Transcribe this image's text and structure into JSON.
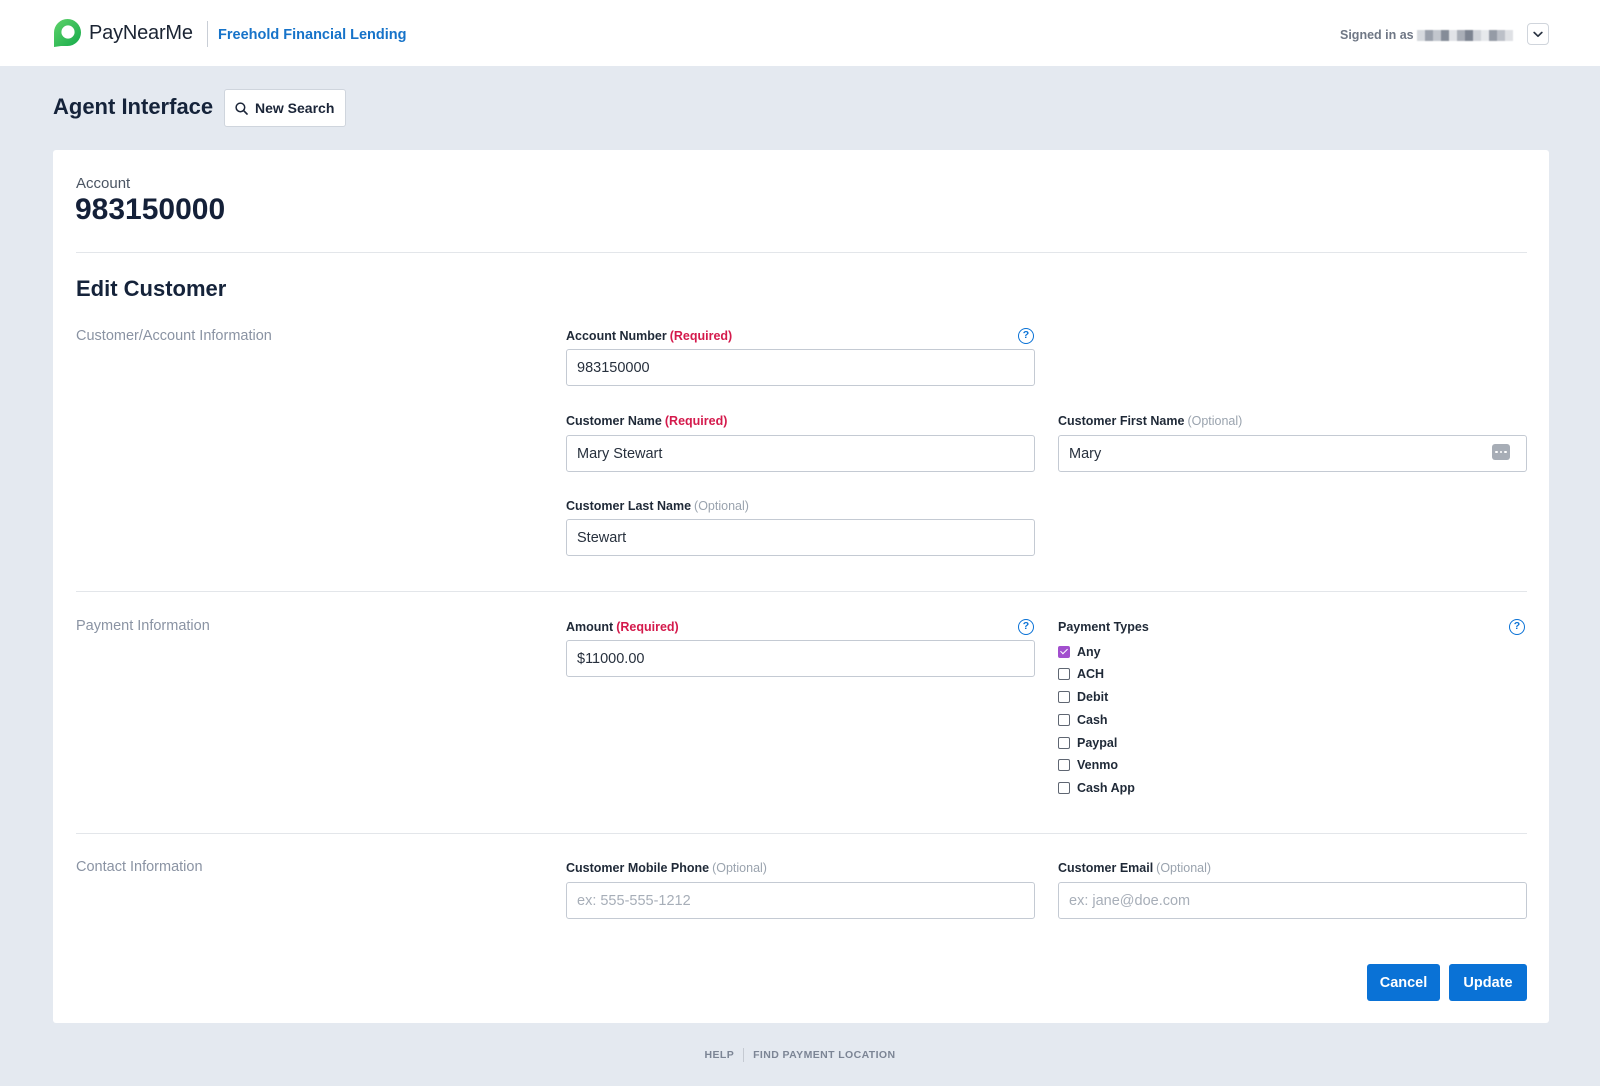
{
  "header": {
    "brand": "PayNearMe",
    "brand_icon": "paynearme-logo-icon",
    "merchant": "Freehold Financial Lending",
    "signed_in_label": "Signed in as",
    "account_menu_icon": "chevron-down-icon"
  },
  "page": {
    "title": "Agent Interface",
    "new_search": {
      "label": "New Search",
      "icon": "search-icon"
    }
  },
  "account": {
    "label": "Account",
    "number": "983150000"
  },
  "form": {
    "title": "Edit Customer"
  },
  "customer_section": {
    "title": "Customer/Account Information",
    "account_number": {
      "label": "Account Number",
      "tag": "(Required)",
      "value": "983150000",
      "help_icon": "help-icon"
    },
    "customer_name": {
      "label": "Customer Name",
      "tag": "(Required)",
      "value": "Mary Stewart"
    },
    "first_name": {
      "label": "Customer First Name",
      "tag": "(Optional)",
      "value": "Mary",
      "icon": "autofill-menu-icon"
    },
    "last_name": {
      "label": "Customer Last Name",
      "tag": "(Optional)",
      "value": "Stewart"
    }
  },
  "payment_section": {
    "title": "Payment Information",
    "amount": {
      "label": "Amount",
      "tag": "(Required)",
      "value": "$11000.00",
      "help_icon": "help-icon"
    },
    "payment_types": {
      "label": "Payment Types",
      "help_icon": "help-icon",
      "options": [
        {
          "label": "Any",
          "checked": true
        },
        {
          "label": "ACH",
          "checked": false
        },
        {
          "label": "Debit",
          "checked": false
        },
        {
          "label": "Cash",
          "checked": false
        },
        {
          "label": "Paypal",
          "checked": false
        },
        {
          "label": "Venmo",
          "checked": false
        },
        {
          "label": "Cash App",
          "checked": false
        }
      ]
    }
  },
  "contact_section": {
    "title": "Contact Information",
    "mobile_phone": {
      "label": "Customer Mobile Phone",
      "tag": "(Optional)",
      "placeholder": "ex: 555-555-1212"
    },
    "email": {
      "label": "Customer Email",
      "tag": "(Optional)",
      "placeholder": "ex: jane@doe.com"
    }
  },
  "actions": {
    "cancel_label": "Cancel",
    "update_label": "Update"
  },
  "footer": {
    "links": [
      "HELP",
      "FIND PAYMENT LOCATION"
    ]
  },
  "colors": {
    "accent": "#0a72d6",
    "link": "#1673c9",
    "required": "#d41a4c",
    "optional": "#9aa3ae",
    "checkbox_checked": "#a24fce",
    "page_background": "#e4e9f0"
  }
}
